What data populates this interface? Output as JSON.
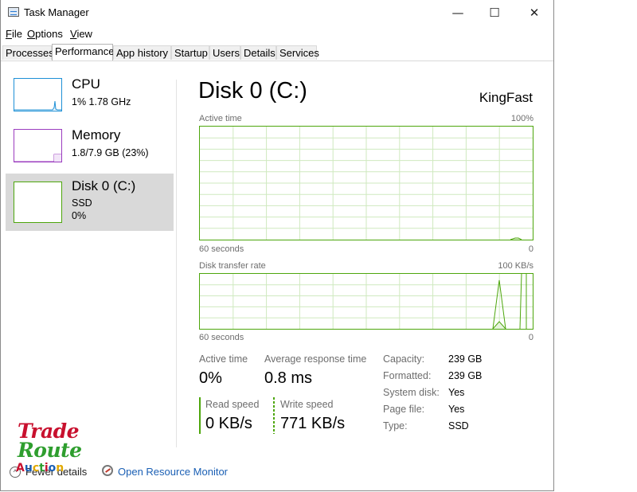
{
  "window": {
    "title": "Task Manager",
    "minimize_glyph": "—",
    "maximize_glyph": "☐",
    "close_glyph": "✕"
  },
  "menu": [
    {
      "first": "F",
      "rest": "ile"
    },
    {
      "first": "O",
      "rest": "ptions"
    },
    {
      "first": "V",
      "rest": "iew"
    }
  ],
  "tabs": [
    "Processes",
    "Performance",
    "App history",
    "Startup",
    "Users",
    "Details",
    "Services"
  ],
  "active_tab": "Performance",
  "sidebar": {
    "items": [
      {
        "name": "CPU",
        "line1": "1%  1.78 GHz",
        "line2": "",
        "color": "#1e90d6",
        "usage_fraction": 0.01
      },
      {
        "name": "Memory",
        "line1": "1.8/7.9 GB (23%)",
        "line2": "",
        "color": "#9b3cbf",
        "usage_fraction": 0.23
      },
      {
        "name": "Disk 0 (C:)",
        "line1": "SSD",
        "line2": "0%",
        "color": "#4da60c",
        "usage_fraction": 0.0
      }
    ],
    "selected": "Disk 0 (C:)"
  },
  "detail": {
    "title": "Disk 0 (C:)",
    "model": "KingFast",
    "graph1": {
      "label": "Active time",
      "max": "100%",
      "time_label": "60 seconds",
      "min": "0"
    },
    "graph2": {
      "label": "Disk transfer rate",
      "max": "100 KB/s",
      "time_label": "60 seconds",
      "min": "0"
    },
    "stats": {
      "active_time_label": "Active time",
      "active_time_value": "0%",
      "avg_response_label": "Average response time",
      "avg_response_value": "0.8 ms",
      "read_speed_label": "Read speed",
      "read_speed_value": "0 KB/s",
      "write_speed_label": "Write speed",
      "write_speed_value": "771 KB/s"
    },
    "properties": [
      {
        "label": "Capacity:",
        "value": "239 GB"
      },
      {
        "label": "Formatted:",
        "value": "239 GB"
      },
      {
        "label": "System disk:",
        "value": "Yes"
      },
      {
        "label": "Page file:",
        "value": "Yes"
      },
      {
        "label": "Type:",
        "value": "SSD"
      }
    ]
  },
  "footer": {
    "fewer_details": "Fewer details",
    "open_monitor": "Open Resource Monitor"
  },
  "watermark": {
    "line1": "Trade",
    "line2": "Route",
    "line3": [
      "A",
      "u",
      "c",
      "t",
      "i",
      "o",
      "n"
    ],
    "line3_colors": [
      "#c8102e",
      "#1a5fb4",
      "#e0a800",
      "#2e9e2e",
      "#c8102e",
      "#1a5fb4",
      "#e0a800"
    ]
  },
  "colors": {
    "disk_green": "#4da60c",
    "grid_green": "#cfe9bf",
    "cpu_blue": "#1e90d6",
    "memory_purple": "#9b3cbf",
    "selected_bg": "#d9d9d9",
    "link_blue": "#1a5fb4"
  }
}
